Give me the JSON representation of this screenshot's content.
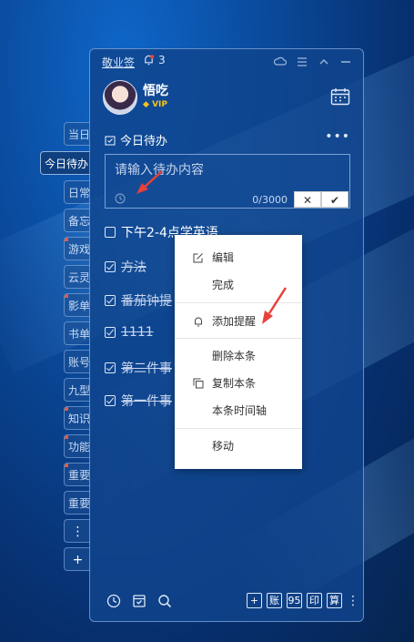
{
  "colors": {
    "accent_red": "#e8413a",
    "panel": "#1044a0",
    "vip_gold": "#f5c518"
  },
  "titlebar": {
    "app_title": "敬业签",
    "notification_count": "3",
    "icons": [
      "cloud-icon",
      "menu-icon",
      "chevron-up-icon",
      "minimize-icon"
    ]
  },
  "user": {
    "name": "悟吃",
    "badge": "VIP"
  },
  "side_tabs": [
    "当日",
    "今日待办",
    "日常",
    "备忘",
    "游戏",
    "云灵",
    "影单",
    "书单",
    "账号",
    "九型",
    "知识",
    "功能",
    "重要",
    "重要",
    "⋮",
    "+"
  ],
  "section": {
    "title": "今日待办",
    "more": "•••"
  },
  "input": {
    "placeholder": "请输入待办内容",
    "counter": "0/3000",
    "cancel": "✕",
    "confirm": "✔"
  },
  "todos": [
    {
      "text": "下午2-4点学英语",
      "done": false
    },
    {
      "text": "方法",
      "done": true
    },
    {
      "text": "番茄钟提",
      "done": true
    },
    {
      "text": "1111",
      "done": true
    },
    {
      "text": "第二件事",
      "done": true
    },
    {
      "text": "第一件事",
      "done": true
    }
  ],
  "context_menu": {
    "edit": "编辑",
    "complete": "完成",
    "add_reminder": "添加提醒",
    "delete": "删除本条",
    "copy": "复制本条",
    "timeline": "本条时间轴",
    "move": "移动"
  },
  "footer": {
    "right_buttons": [
      "+",
      "账",
      "95",
      "印",
      "算"
    ]
  }
}
